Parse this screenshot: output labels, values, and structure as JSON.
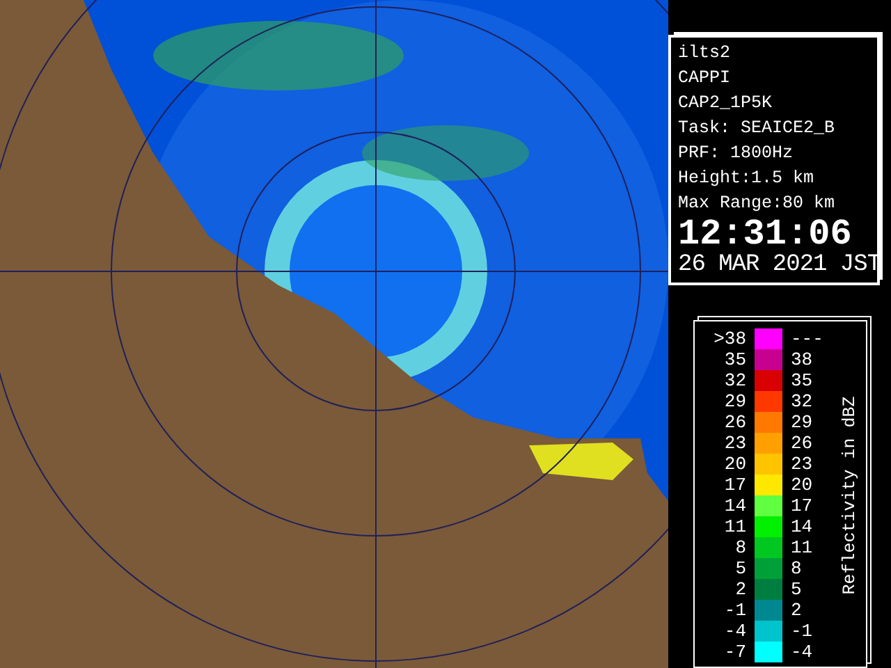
{
  "info_panel": {
    "lines": [
      "ilts2",
      "CAPPI",
      "CAP2_1P5K",
      "Task: SEAICE2_B",
      "PRF: 1800Hz",
      "Height:1.5 km",
      "Max Range:80 km"
    ],
    "time": "12:31:06",
    "date": "26 MAR 2021 JST"
  },
  "legend": {
    "title": "Reflectivity in dBZ",
    "rows": [
      {
        "low": ">38",
        "high": "---",
        "color": "#ff00ff"
      },
      {
        "low": "35",
        "high": "38",
        "color": "#c80090"
      },
      {
        "low": "32",
        "high": "35",
        "color": "#d80000"
      },
      {
        "low": "29",
        "high": "32",
        "color": "#ff3800"
      },
      {
        "low": "26",
        "high": "29",
        "color": "#ff7800"
      },
      {
        "low": "23",
        "high": "26",
        "color": "#ffa000"
      },
      {
        "low": "20",
        "high": "23",
        "color": "#ffc400"
      },
      {
        "low": "17",
        "high": "20",
        "color": "#ffe800"
      },
      {
        "low": "14",
        "high": "17",
        "color": "#60ff40"
      },
      {
        "low": "11",
        "high": "14",
        "color": "#00f000"
      },
      {
        "low": "8",
        "high": "11",
        "color": "#00c820"
      },
      {
        "low": "5",
        "high": "8",
        "color": "#00a038"
      },
      {
        "low": "2",
        "high": "5",
        "color": "#007e40"
      },
      {
        "low": "-1",
        "high": "2",
        "color": "#008890"
      },
      {
        "low": "-4",
        "high": "-1",
        "color": "#00c4cc"
      },
      {
        "low": "-7",
        "high": "-4",
        "color": "#00ffff"
      }
    ]
  }
}
